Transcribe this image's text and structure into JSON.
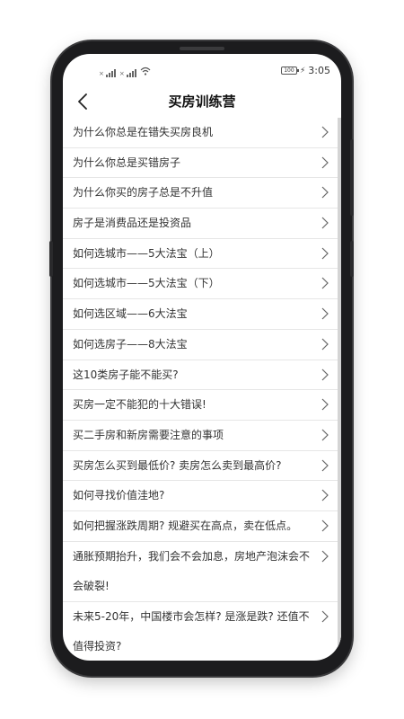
{
  "status_bar": {
    "signal_label": "×",
    "battery": "100",
    "time": "3:05"
  },
  "header": {
    "title": "买房训练营"
  },
  "list": {
    "items": [
      {
        "label": "为什么你总是在错失买房良机"
      },
      {
        "label": "为什么你总是买错房子"
      },
      {
        "label": "为什么你买的房子总是不升值"
      },
      {
        "label": "房子是消费品还是投资品"
      },
      {
        "label": "如何选城市——5大法宝（上）"
      },
      {
        "label": "如何选城市——5大法宝（下）"
      },
      {
        "label": "如何选区域——6大法宝"
      },
      {
        "label": "如何选房子——8大法宝"
      },
      {
        "label": "这10类房子能不能买?"
      },
      {
        "label": "买房一定不能犯的十大错误!"
      },
      {
        "label": "买二手房和新房需要注意的事项"
      },
      {
        "label": "买房怎么买到最低价? 卖房怎么卖到最高价?"
      },
      {
        "label": "如何寻找价值洼地?"
      },
      {
        "label": "如何把握涨跌周期? 规避买在高点，卖在低点。"
      },
      {
        "label": "通胀预期抬升，我们会不会加息，房地产泡沫会不会破裂!"
      },
      {
        "label": "未来5-20年，中国楼市会怎样? 是涨是跌? 还值不值得投资?"
      }
    ]
  },
  "icons": {
    "back": "chevron-left-icon",
    "row_arrow": "chevron-right-icon",
    "wifi": "wifi-icon",
    "battery": "battery-icon",
    "charging": "bolt-icon"
  }
}
